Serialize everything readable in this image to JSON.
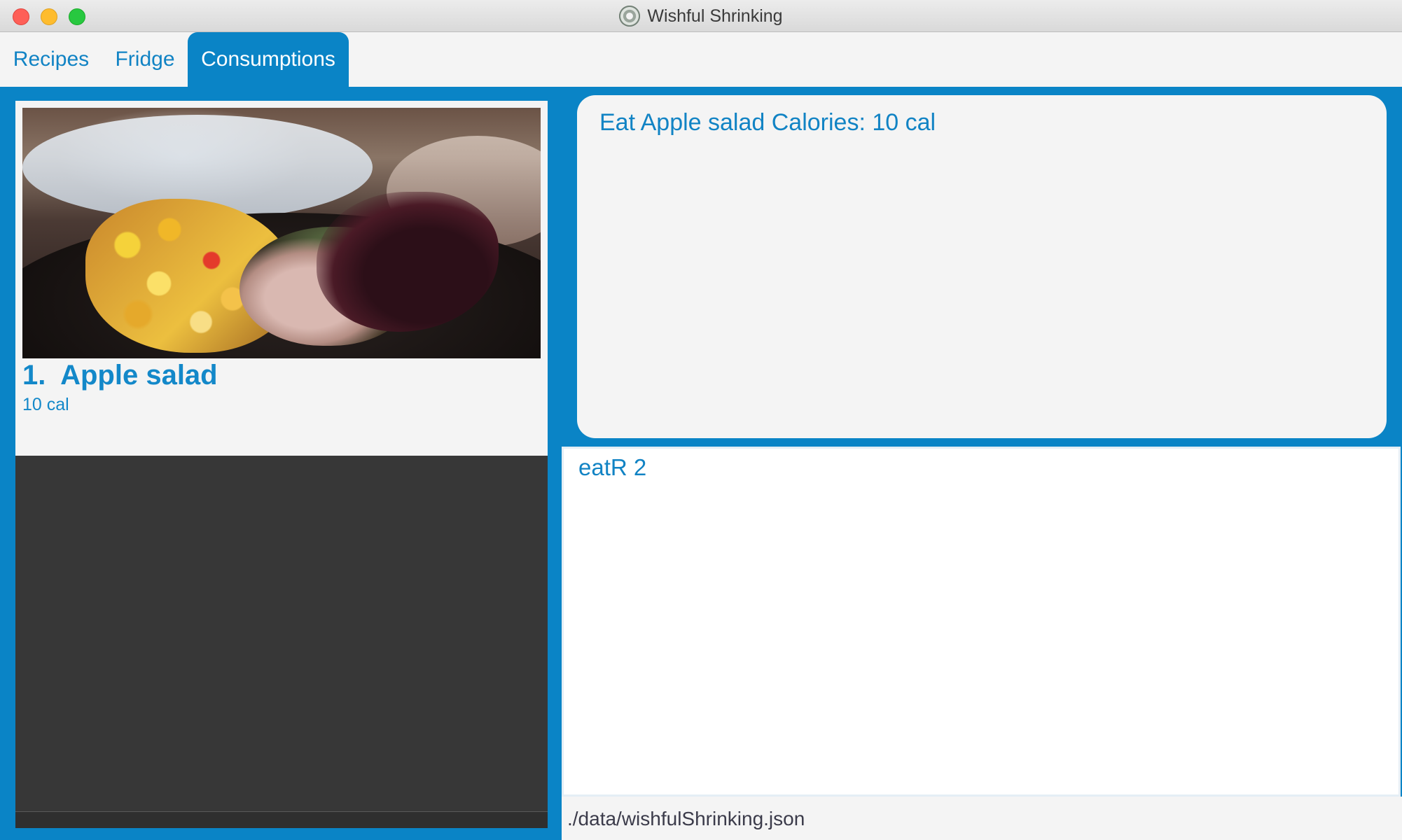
{
  "window": {
    "title": "Wishful Shrinking",
    "app_icon": "plate-icon"
  },
  "tabs": [
    {
      "label": "Recipes",
      "selected": false
    },
    {
      "label": "Fridge",
      "selected": false
    },
    {
      "label": "Consumptions",
      "selected": true
    }
  ],
  "consumption_list": {
    "items": [
      {
        "index": "1.",
        "name": "Apple salad",
        "title": "1.  Apple salad",
        "calories": "10 cal",
        "image": "food-photo"
      }
    ]
  },
  "result_display": {
    "text": "Eat Apple salad Calories: 10 cal"
  },
  "command_box": {
    "value": "eatR 2"
  },
  "status_bar": {
    "file_path": "./data/wishfulShrinking.json"
  },
  "colors": {
    "accent": "#0a84c6",
    "text_blue": "#1183c4",
    "panel_bg": "#f4f4f4",
    "list_bg": "#373737"
  }
}
